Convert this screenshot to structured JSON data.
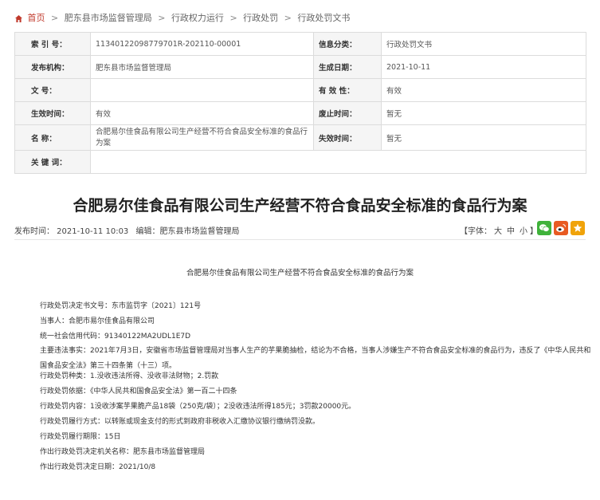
{
  "breadcrumb": [
    "首页",
    "肥东县市场监督管理局",
    "行政权力运行",
    "行政处罚",
    "行政处罚文书"
  ],
  "meta": {
    "index_label": "索  引  号：",
    "index_value": "11340122098779701R-202110-00001",
    "category_label": "信息分类：",
    "category_value": "行政处罚文书",
    "publisher_label": "发布机构：",
    "publisher_value": "肥东县市场监督管理局",
    "created_label": "生成日期：",
    "created_value": "2021-10-11",
    "docno_label": "文    号：",
    "docno_value": "",
    "validity_label": "有  效  性：",
    "validity_value": "有效",
    "effective_label": "生效时间：",
    "effective_value": "有效",
    "repeal_label": "废止时间：",
    "repeal_value": "暂无",
    "name_label": "名    称：",
    "name_value": "合肥易尔佳食品有限公司生产经营不符合食品安全标准的食品行为案",
    "expire_label": "失效时间：",
    "expire_value": "暂无",
    "keywords_label": "关  键  词：",
    "keywords_value": ""
  },
  "article": {
    "title": "合肥易尔佳食品有限公司生产经营不符合食品安全标准的食品行为案",
    "published": "发布时间：  2021-10-11 10:03",
    "editor": "编辑：肥东县市场监督管理局",
    "font_label": "【字体：",
    "font_large": "大",
    "font_medium": "中",
    "font_small": "小",
    "font_close": "】"
  },
  "share_icons": [
    "wechat-icon",
    "weibo-icon",
    "favorite-icon"
  ],
  "colors": {
    "home_red": "#c0392b",
    "wechat": "#3fb23a",
    "weibo": "#e85a22",
    "star": "#f0a30a"
  },
  "document": {
    "heading": "合肥易尔佳食品有限公司生产经营不符合食品安全标准的食品行为案",
    "lines": [
      "行政处罚决定书文号：东市监罚字〔2021〕121号",
      "当事人：合肥市易尔佳食品有限公司",
      "统一社会信用代码：91340122MA2UDL1E7D",
      "主要违法事实：2021年7月3日，安徽省市场监督管理局对当事人生产的芋果脆抽检，结论为不合格，当事人涉嫌生产不符合食品安全标准的食品行为，违反了《中华人民共和国食品安全法》第三十四条第（十三）项。",
      "行政处罚种类：1.没收违法所得、没收非法财物；2.罚款",
      "行政处罚依据：《中华人民共和国食品安全法》第一百二十四条",
      "行政处罚内容：1没收涉案芋果脆产品18袋（250克/袋）；2没收违法所得185元；3罚款20000元。",
      "行政处罚履行方式：以转账或现金支付的形式到政府非税收入汇缴协议银行缴纳罚没款。",
      "行政处罚履行期限：15日",
      "作出行政处罚决定机关名称：肥东县市场监督管理局",
      "作出行政处罚决定日期：2021/10/8"
    ]
  }
}
